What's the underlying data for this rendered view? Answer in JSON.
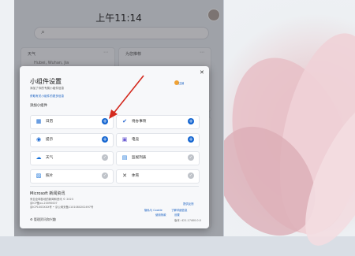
{
  "panel": {
    "time": "上午11:14",
    "cards": [
      {
        "title": "天气",
        "subtitle": "Hubei, Wuhan, Jia"
      },
      {
        "title": "为您推荐",
        "subtitle": ""
      }
    ]
  },
  "dialog": {
    "title": "小组件设置",
    "desc_line1": "添加了你的专属小组件信息",
    "desc_line2": "",
    "desc_link": "获取有关小组件的更多信息",
    "side_link": "注销",
    "section": "添加小组件",
    "widgets": [
      {
        "label": "日历",
        "icon": "calendar-icon",
        "glyph": "▦",
        "color": "#1566d1",
        "state": "add"
      },
      {
        "label": "待办事项",
        "icon": "todo-icon",
        "glyph": "✔",
        "color": "#2564cf",
        "state": "add"
      },
      {
        "label": "提示",
        "icon": "tips-icon",
        "glyph": "◉",
        "color": "#1566d1",
        "state": "add"
      },
      {
        "label": "电竞",
        "icon": "esports-icon",
        "glyph": "▣",
        "color": "#6b5bd2",
        "state": "add"
      },
      {
        "label": "天气",
        "icon": "weather-icon",
        "glyph": "☁",
        "color": "#1a73d9",
        "state": "done"
      },
      {
        "label": "监视列表",
        "icon": "watchlist-icon",
        "glyph": "▤",
        "color": "#1a73d9",
        "state": "done"
      },
      {
        "label": "照片",
        "icon": "photos-icon",
        "glyph": "▨",
        "color": "#1a73d9",
        "state": "done"
      },
      {
        "label": "体育",
        "icon": "sports-icon",
        "glyph": "✕",
        "color": "#444",
        "state": "done"
      }
    ],
    "ms": {
      "title": "Microsoft 新闻资讯",
      "line1": "来自全球各地的新闻和资讯 © 2023",
      "line2": "京ICP备xx-20090007",
      "line3": "京ICP1003XXX号 • 京公网安备1101080202497号",
      "link_privacy": "提供反馈",
      "link_terms": "隐私与 Cookie",
      "link_conditions": "使用条款",
      "link_about": "了解详细信息",
      "link_settings": "设置",
      "version": "版本: 421.17400.0.0"
    },
    "manage": "管理资讯和兴趣"
  }
}
